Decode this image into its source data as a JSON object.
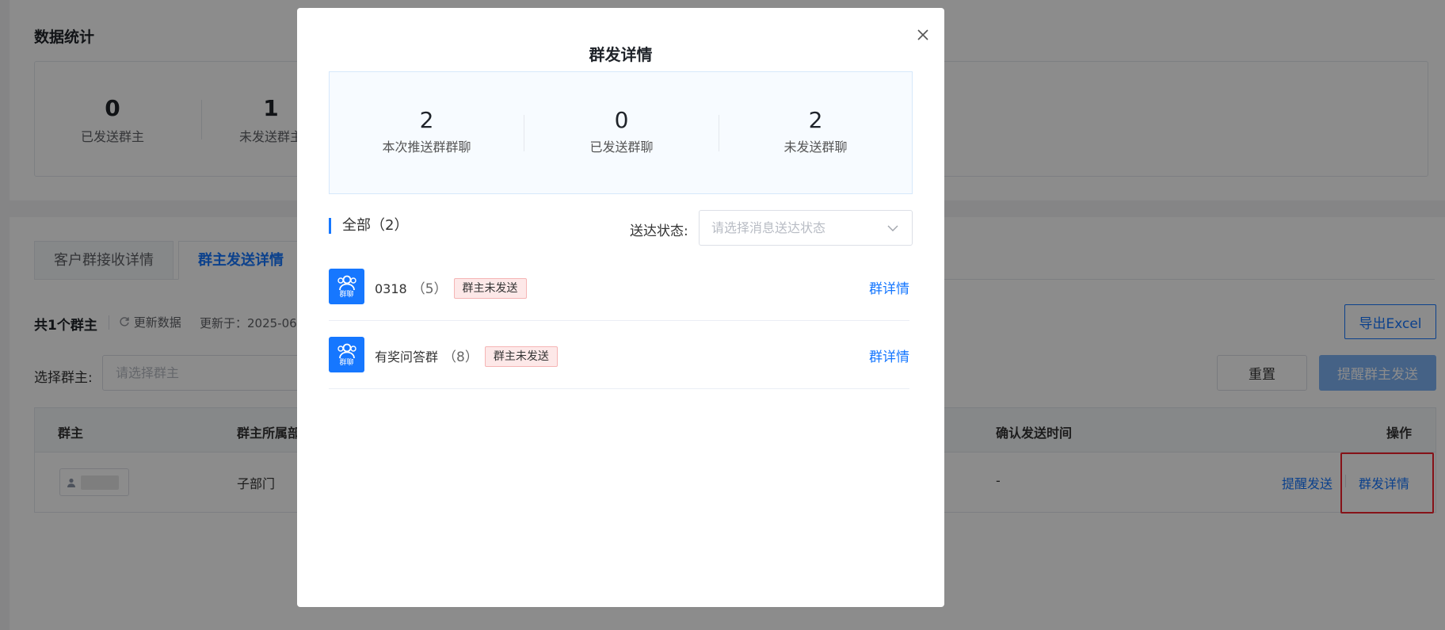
{
  "background": {
    "stats_title": "数据统计",
    "stats": [
      {
        "value": "0",
        "label": "已发送群主"
      },
      {
        "value": "1",
        "label": "未发送群主"
      }
    ],
    "tabs": [
      {
        "label": "客户群接收详情",
        "active": false
      },
      {
        "label": "群主发送详情",
        "active": true
      }
    ],
    "total_label": "共1个群主",
    "refresh_label": "更新数据",
    "updated_label": "更新于：2025-06",
    "export_label": "导出Excel",
    "owner_label": "选择群主:",
    "owner_placeholder": "请选择群主",
    "reset_label": "重置",
    "remind_all_label": "提醒群主发送",
    "table": {
      "headers": {
        "owner": "群主",
        "dept": "群主所属部门",
        "confirm_time": "确认发送时间",
        "ops": "操作"
      },
      "rows": [
        {
          "dept": "子部门",
          "confirm_time": "-",
          "remind": "提醒发送",
          "detail": "群发详情"
        }
      ]
    }
  },
  "dialog": {
    "title": "群发详情",
    "stats": [
      {
        "value": "2",
        "label": "本次推送群群聊"
      },
      {
        "value": "0",
        "label": "已发送群聊"
      },
      {
        "value": "2",
        "label": "未发送群聊"
      }
    ],
    "all_label": "全部（2）",
    "status_label": "送达状态:",
    "status_placeholder": "请选择消息送达状态",
    "groups": [
      {
        "avatar_caption": "群聊",
        "name": "0318",
        "count": "（5）",
        "badge": "群主未发送",
        "link": "群详情"
      },
      {
        "avatar_caption": "群聊",
        "name": "有奖问答群",
        "count": "（8）",
        "badge": "群主未发送",
        "link": "群详情"
      }
    ]
  },
  "colors": {
    "primary": "#1677ff",
    "badge_bg": "#fde8e8",
    "badge_border": "#f5b5b5",
    "highlight": "#f5222d"
  }
}
